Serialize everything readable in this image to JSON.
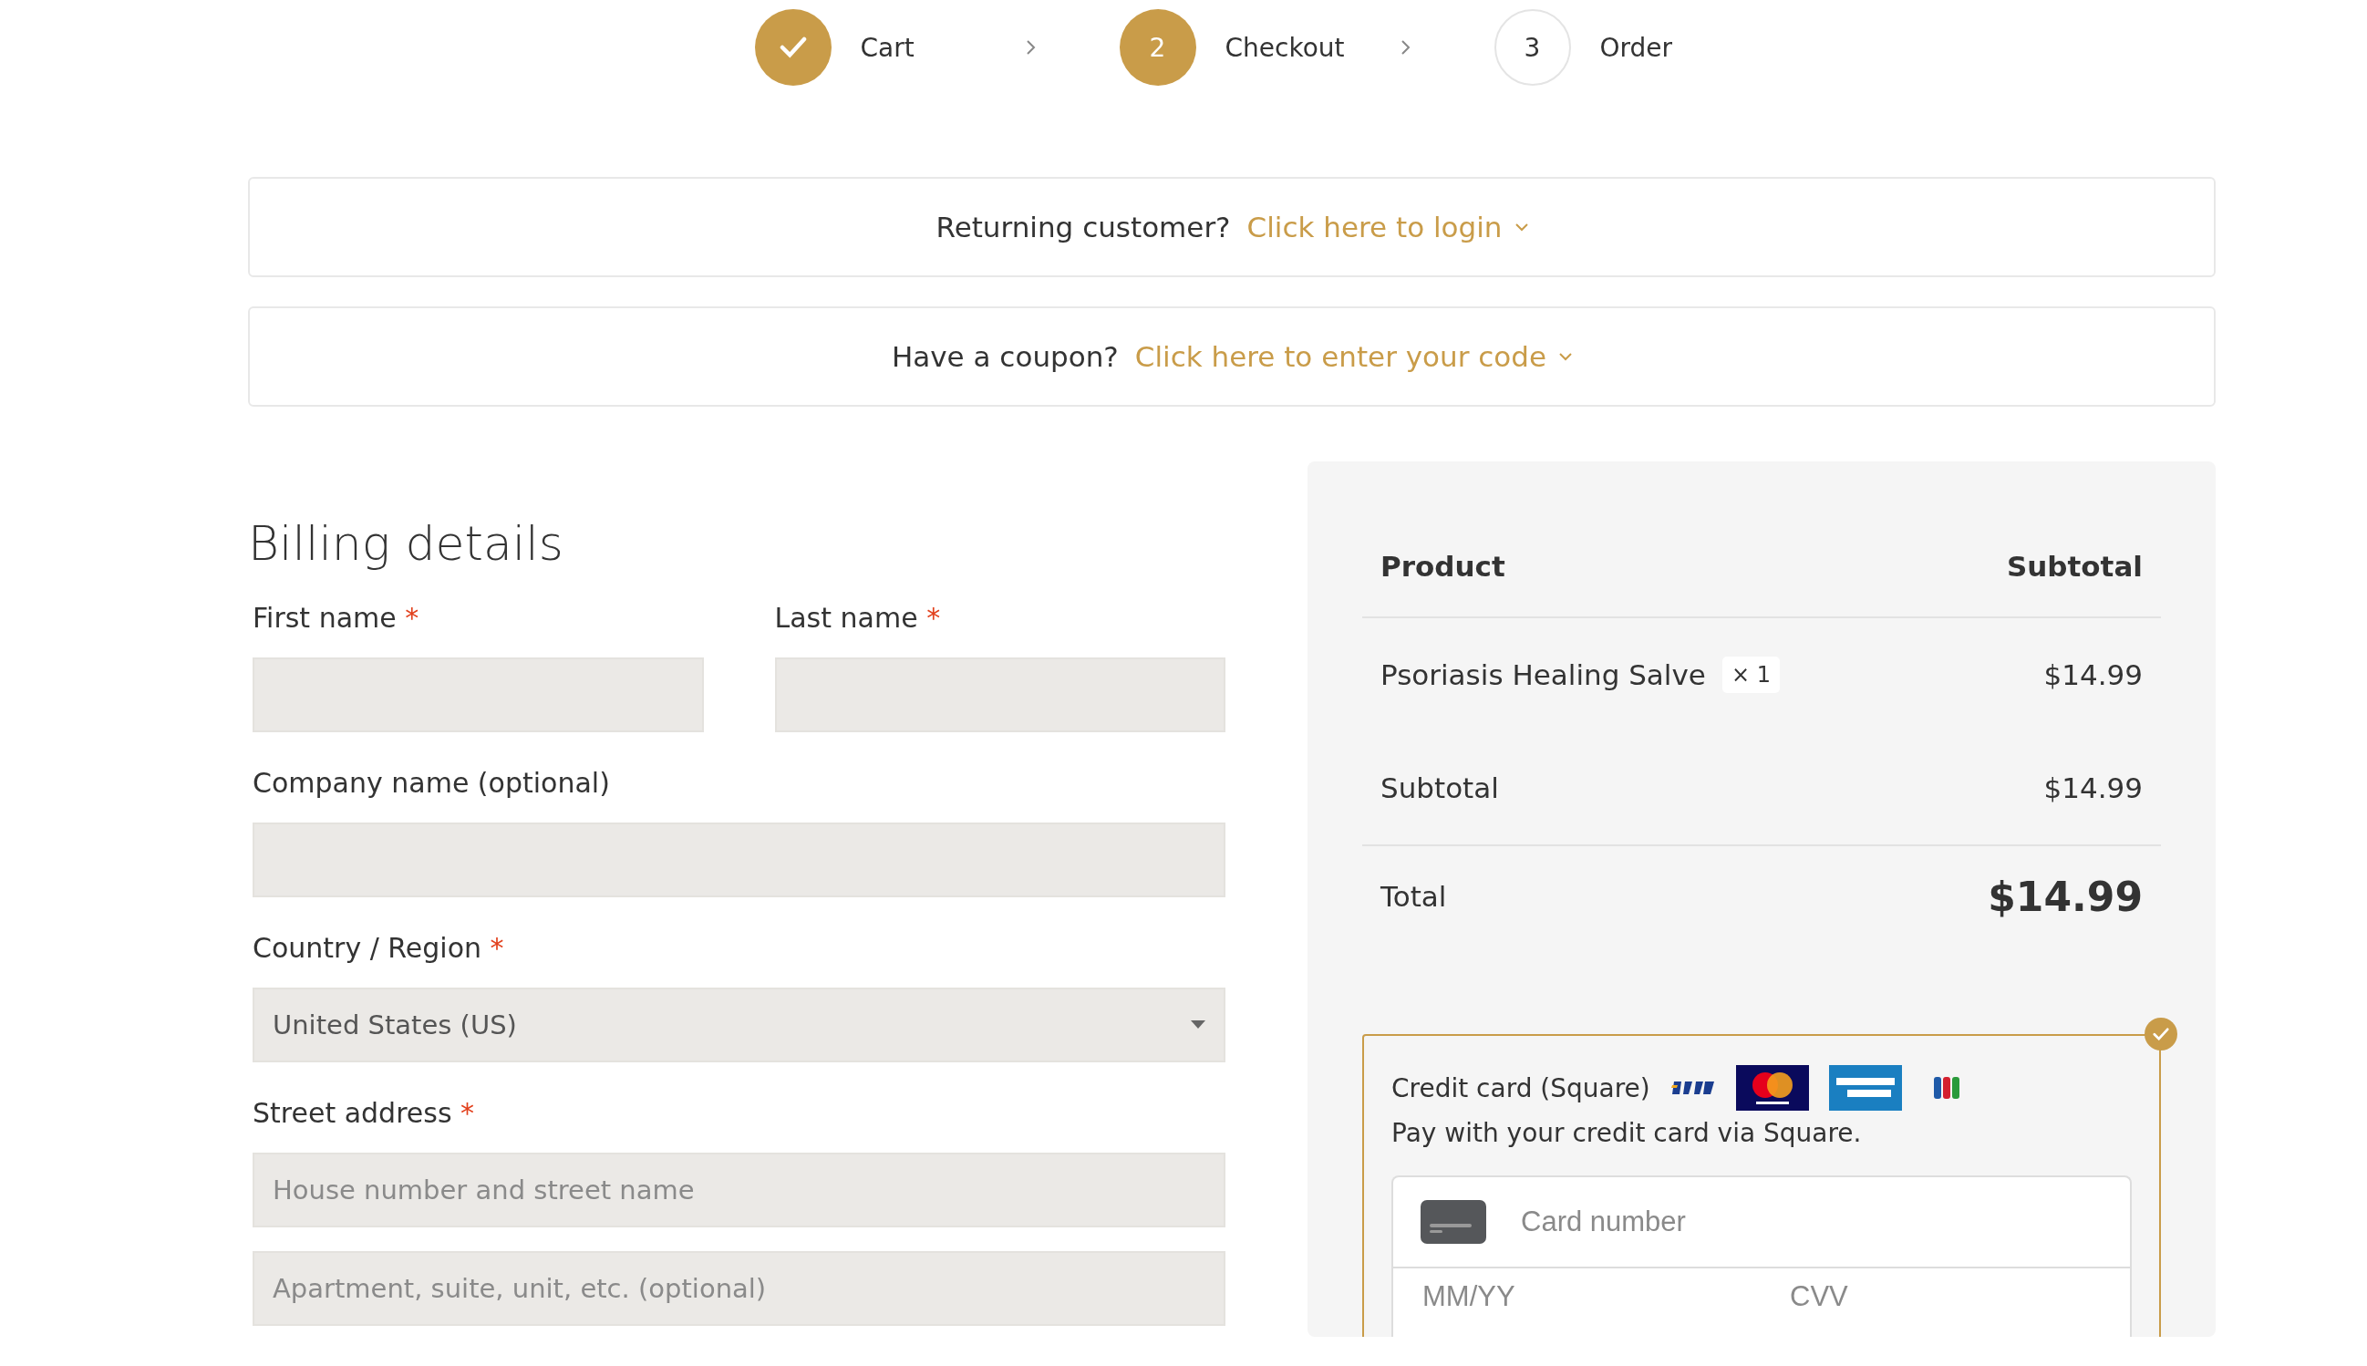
{
  "steps": [
    {
      "label": "Cart",
      "kind": "done"
    },
    {
      "label": "Checkout",
      "number": "2",
      "kind": "current"
    },
    {
      "label": "Order",
      "number": "3",
      "kind": "upcoming"
    }
  ],
  "notices": [
    {
      "text": "Returning customer?",
      "link": "Click here to login"
    },
    {
      "text": "Have a coupon?",
      "link": "Click here to enter your code"
    }
  ],
  "billing": {
    "title": "Billing details",
    "rows": [
      [
        {
          "label": "First name",
          "required_mark": "*",
          "inputs": [
            {
              "kind": "text"
            }
          ]
        },
        {
          "label": "Last name",
          "required_mark": "*",
          "inputs": [
            {
              "kind": "text"
            }
          ]
        }
      ],
      [
        {
          "label": "Company name (optional)",
          "inputs": [
            {
              "kind": "text"
            }
          ]
        }
      ],
      [
        {
          "label": "Country / Region",
          "required_mark": "*",
          "inputs": [
            {
              "kind": "select",
              "value": "United States (US)"
            }
          ]
        }
      ],
      [
        {
          "label": "Street address",
          "required_mark": "*",
          "inputs": [
            {
              "kind": "text",
              "placeholder": "House number and street name"
            },
            {
              "kind": "text",
              "placeholder": "Apartment, suite, unit, etc. (optional)"
            }
          ]
        }
      ]
    ]
  },
  "order": {
    "columns": [
      "Product",
      "Subtotal"
    ],
    "items": [
      {
        "name": "Psoriasis Healing Salve",
        "quantity": "× 1",
        "price": "$14.99"
      }
    ],
    "subtotal": {
      "label": "Subtotal",
      "value": "$14.99"
    },
    "total": {
      "label": "Total",
      "value": "$14.99"
    }
  },
  "payment": {
    "label": "Credit card (Square)",
    "selected": true,
    "description": "Pay with your credit card via Square.",
    "card_number": {
      "placeholder": "Card number"
    },
    "expiry": {
      "placeholder": "MM/YY"
    },
    "cvv": {
      "placeholder": "CVV"
    }
  }
}
